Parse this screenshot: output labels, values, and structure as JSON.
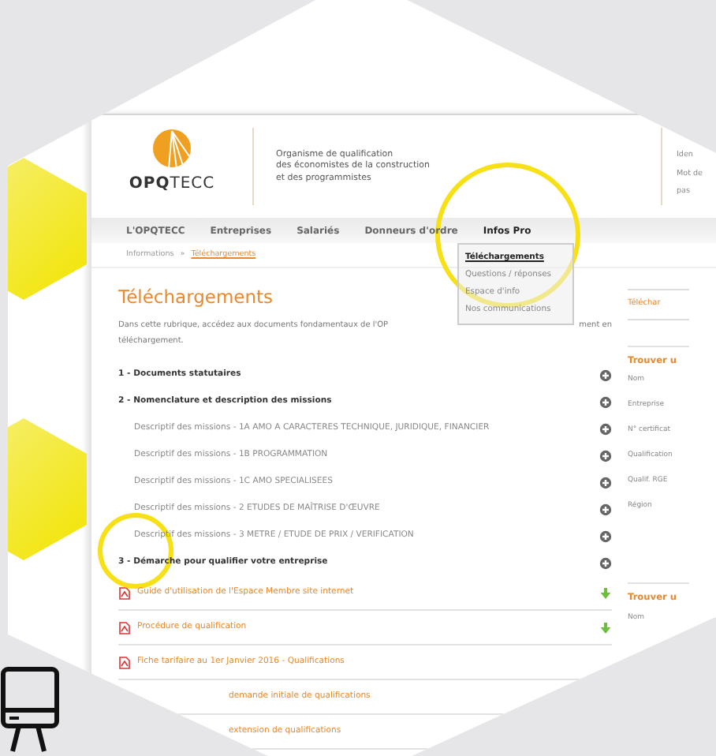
{
  "logo": {
    "text": "**OPQ**TECC"
  },
  "tagline": [
    "Organisme de qualification",
    "des économistes de la construction",
    "et des programmistes"
  ],
  "login": [
    "Iden",
    "Mot de pas"
  ],
  "nav": [
    {
      "label": "L'OPQTECC",
      "selected": false
    },
    {
      "label": "Entreprises",
      "selected": false
    },
    {
      "label": "Salariés",
      "selected": false
    },
    {
      "label": "Donneurs d'ordre",
      "selected": false
    },
    {
      "label": "Infos Pro",
      "selected": true
    }
  ],
  "breadcrumb": {
    "items": [
      "Informations",
      "Téléchargements"
    ],
    "separator": "»"
  },
  "dropdown": [
    {
      "label": "Téléchargements",
      "selected": true
    },
    {
      "label": "Questions / réponses",
      "selected": false
    },
    {
      "label": "Espace d'info",
      "selected": false
    },
    {
      "label": "Nos communications",
      "selected": false
    }
  ],
  "title": "Téléchargements",
  "intro": {
    "line_1": "Dans cette rubrique, accédez aux documents fondamentaux de l'OP",
    "line_1_end": "ment en",
    "line_2": "téléchargement."
  },
  "rows": [
    {
      "kind": "heading",
      "label": "1 - Documents statutaires"
    },
    {
      "kind": "heading",
      "label": "2 - Nomenclature et description des missions"
    },
    {
      "kind": "subitem",
      "label": "Descriptif des missions - 1A AMO A CARACTERES TECHNIQUE, JURIDIQUE, FINANCIER"
    },
    {
      "kind": "subitem",
      "label": "Descriptif des missions - 1B PROGRAMMATION"
    },
    {
      "kind": "subitem",
      "label": "Descriptif des missions - 1C AMO SPECIALISEES"
    },
    {
      "kind": "subitem",
      "label": "Descriptif des missions - 2 ETUDES DE MAÎTRISE D'ŒUVRE"
    },
    {
      "kind": "subitem",
      "label": "Descriptif des missions - 3 METRE / ETUDE DE PRIX / VERIFICATION"
    },
    {
      "kind": "heading",
      "label": "3 - Démarche pour qualifier votre entreprise"
    },
    {
      "kind": "download",
      "label": "Guide d'utilisation de l'Espace Membre site internet"
    },
    {
      "kind": "download",
      "label": "Procédure de qualification"
    },
    {
      "kind": "document",
      "label": "Fiche tarifaire au 1er Janvier 2016 - Qualifications"
    },
    {
      "kind": "document-cut",
      "label": "demande initiale de qualifications"
    },
    {
      "kind": "document-cut",
      "label": "extension de qualifications"
    }
  ],
  "sidebar": {
    "box_title": "Téléchar",
    "search_1": {
      "title": "Trouver u",
      "fields": [
        "Nom",
        "Entreprise",
        "N° certificat",
        "Qualification",
        "Qualif. RGE",
        "Région"
      ]
    },
    "search_2": {
      "title": "Trouver u",
      "fields": [
        "Nom"
      ]
    }
  }
}
